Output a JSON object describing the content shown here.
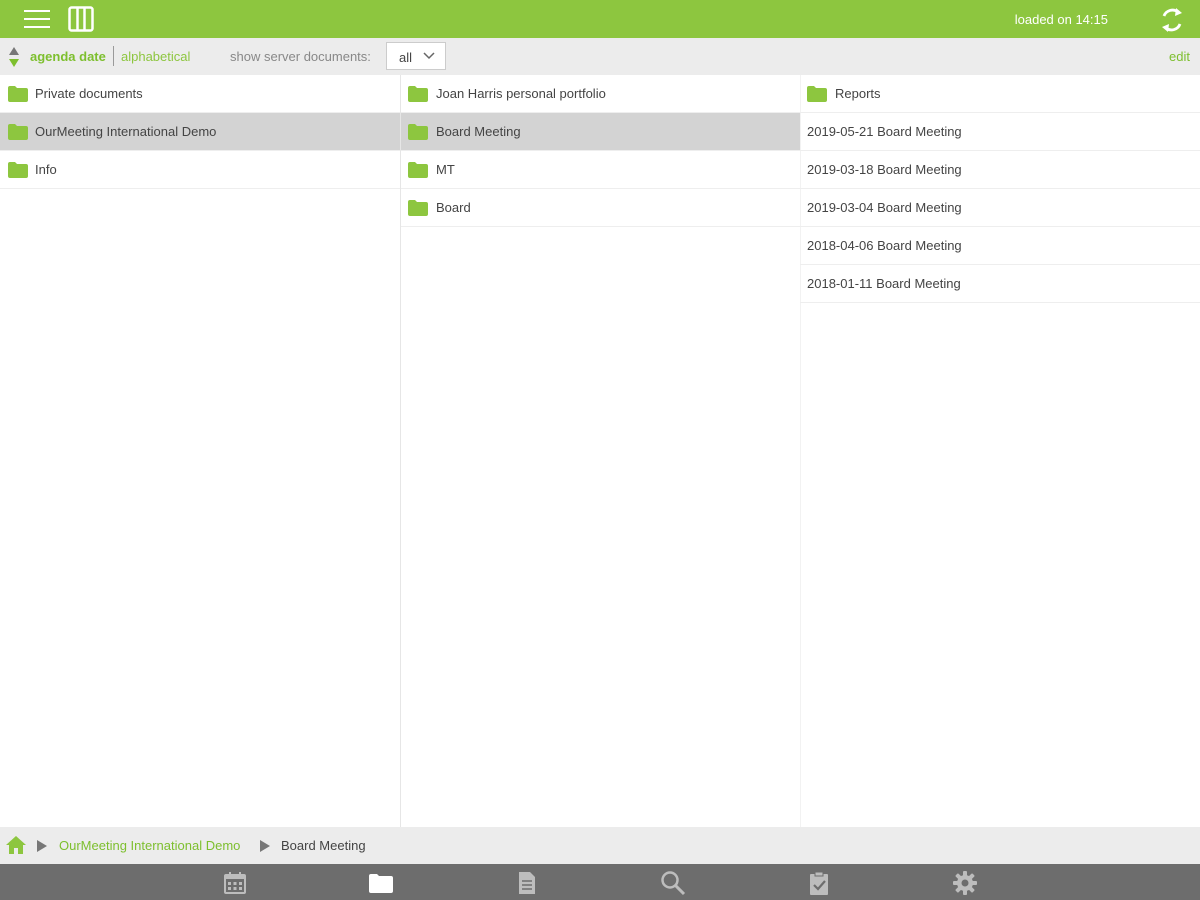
{
  "header": {
    "loaded_text": "loaded on 14:15",
    "menu_icon": "hamburger-icon",
    "columns_icon": "columns-icon",
    "refresh_icon": "refresh-icon",
    "bar_color": "#8dc63f"
  },
  "toolbar": {
    "sort_active": "agenda date",
    "sort_inactive": "alphabetical",
    "show_label": "show server documents:",
    "show_value": "all",
    "edit_label": "edit"
  },
  "columns": {
    "col1": [
      {
        "label": "Private documents",
        "type": "folder",
        "selected": false
      },
      {
        "label": "OurMeeting International Demo",
        "type": "folder",
        "selected": true
      },
      {
        "label": "Info",
        "type": "folder",
        "selected": false
      }
    ],
    "col2": [
      {
        "label": "Joan Harris personal portfolio",
        "type": "folder",
        "selected": false
      },
      {
        "label": "Board Meeting",
        "type": "folder",
        "selected": true
      },
      {
        "label": "MT",
        "type": "folder",
        "selected": false
      },
      {
        "label": "Board",
        "type": "folder",
        "selected": false
      }
    ],
    "col3": [
      {
        "label": "Reports",
        "type": "folder",
        "selected": false
      },
      {
        "label": "2019-05-21 Board Meeting",
        "type": "meeting",
        "selected": false
      },
      {
        "label": "2019-03-18 Board Meeting",
        "type": "meeting",
        "selected": false
      },
      {
        "label": "2019-03-04 Board Meeting",
        "type": "meeting",
        "selected": false
      },
      {
        "label": "2018-04-06 Board Meeting",
        "type": "meeting",
        "selected": false
      },
      {
        "label": "2018-01-11 Board Meeting",
        "type": "meeting",
        "selected": false
      }
    ]
  },
  "breadcrumb": {
    "home_icon": "home-icon",
    "link": "OurMeeting International Demo",
    "current": "Board Meeting"
  },
  "tabbar": {
    "tabs": [
      {
        "icon": "calendar-icon",
        "active": false
      },
      {
        "icon": "folder-icon",
        "active": true
      },
      {
        "icon": "document-icon",
        "active": false
      },
      {
        "icon": "search-icon",
        "active": false
      },
      {
        "icon": "clipboard-check-icon",
        "active": false
      },
      {
        "icon": "gear-icon",
        "active": false
      }
    ]
  }
}
